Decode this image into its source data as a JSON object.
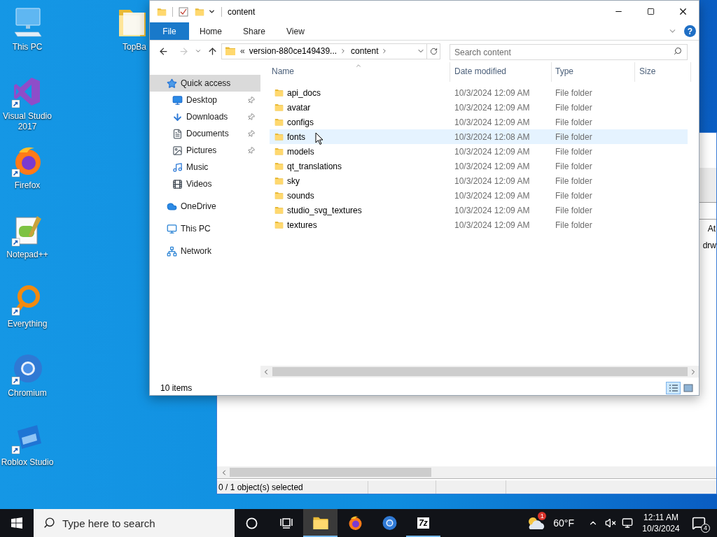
{
  "desktop": {
    "icons": [
      {
        "label": "This PC",
        "kind": "computer",
        "shortcut": false
      },
      {
        "label": "Visual Studio 2017",
        "kind": "vs",
        "shortcut": true
      },
      {
        "label": "Firefox",
        "kind": "firefox",
        "shortcut": true
      },
      {
        "label": "Notepad++",
        "kind": "notepad",
        "shortcut": true
      },
      {
        "label": "Everything",
        "kind": "everything",
        "shortcut": true
      },
      {
        "label": "Chromium",
        "kind": "chromium",
        "shortcut": true
      },
      {
        "label": "Roblox Studio",
        "kind": "roblox",
        "shortcut": true
      }
    ],
    "partial_icon": {
      "label": "TopBa",
      "kind": "folder",
      "shortcut": false
    }
  },
  "background_window": {
    "header_cell": "At",
    "row_cell": "drw",
    "status_bar": "0 / 1 object(s) selected"
  },
  "explorer": {
    "title": "content",
    "help": "?",
    "ribbon_tabs": [
      {
        "label": "File",
        "selected": true
      },
      {
        "label": "Home",
        "selected": false
      },
      {
        "label": "Share",
        "selected": false
      },
      {
        "label": "View",
        "selected": false
      }
    ],
    "address": {
      "overflow": "«",
      "segments": [
        "version-880ce149439...",
        "content"
      ]
    },
    "search": {
      "placeholder": "Search content"
    },
    "nav": [
      {
        "label": "Quick access",
        "kind": "star",
        "selected": true,
        "children": [
          {
            "label": "Desktop",
            "kind": "desktop",
            "pinned": true,
            "selected": false
          },
          {
            "label": "Downloads",
            "kind": "downloads",
            "pinned": true,
            "selected": false
          },
          {
            "label": "Documents",
            "kind": "documents",
            "pinned": true,
            "selected": false
          },
          {
            "label": "Pictures",
            "kind": "pictures",
            "pinned": true,
            "selected": false
          },
          {
            "label": "Music",
            "kind": "music",
            "pinned": false,
            "selected": false
          },
          {
            "label": "Videos",
            "kind": "videos",
            "pinned": false,
            "selected": false
          }
        ]
      },
      {
        "label": "OneDrive",
        "kind": "cloud",
        "selected": false
      },
      {
        "label": "This PC",
        "kind": "computer",
        "selected": false
      },
      {
        "label": "Network",
        "kind": "network",
        "selected": false
      }
    ],
    "columns": [
      {
        "label": "Name",
        "sorted": true
      },
      {
        "label": "Date modified",
        "sorted": false
      },
      {
        "label": "Type",
        "sorted": false
      },
      {
        "label": "Size",
        "sorted": false
      }
    ],
    "rows": [
      {
        "name": "api_docs",
        "date": "10/3/2024 12:09 AM",
        "type": "File folder",
        "hovered": false
      },
      {
        "name": "avatar",
        "date": "10/3/2024 12:09 AM",
        "type": "File folder",
        "hovered": false
      },
      {
        "name": "configs",
        "date": "10/3/2024 12:09 AM",
        "type": "File folder",
        "hovered": false
      },
      {
        "name": "fonts",
        "date": "10/3/2024 12:08 AM",
        "type": "File folder",
        "hovered": true
      },
      {
        "name": "models",
        "date": "10/3/2024 12:09 AM",
        "type": "File folder",
        "hovered": false
      },
      {
        "name": "qt_translations",
        "date": "10/3/2024 12:09 AM",
        "type": "File folder",
        "hovered": false
      },
      {
        "name": "sky",
        "date": "10/3/2024 12:09 AM",
        "type": "File folder",
        "hovered": false
      },
      {
        "name": "sounds",
        "date": "10/3/2024 12:09 AM",
        "type": "File folder",
        "hovered": false
      },
      {
        "name": "studio_svg_textures",
        "date": "10/3/2024 12:09 AM",
        "type": "File folder",
        "hovered": false
      },
      {
        "name": "textures",
        "date": "10/3/2024 12:09 AM",
        "type": "File folder",
        "hovered": false
      }
    ],
    "status": "10 items",
    "views": [
      {
        "kind": "details",
        "selected": true
      },
      {
        "kind": "large_icons",
        "selected": false
      }
    ]
  },
  "taskbar": {
    "search_placeholder": "Type here to search",
    "apps": [
      {
        "kind": "cortana",
        "running": false,
        "active": false
      },
      {
        "kind": "taskview",
        "running": false,
        "active": false
      },
      {
        "kind": "explorer",
        "running": true,
        "active": true
      },
      {
        "kind": "firefox",
        "running": false,
        "active": false
      },
      {
        "kind": "chromium",
        "running": false,
        "active": false
      },
      {
        "kind": "sevenzip",
        "label": "7z",
        "running": true,
        "active": false
      }
    ],
    "weather": {
      "badge": "1",
      "temperature": "60°F"
    },
    "clock": {
      "time": "12:11 AM",
      "date": "10/3/2024"
    },
    "notifications": "4"
  }
}
